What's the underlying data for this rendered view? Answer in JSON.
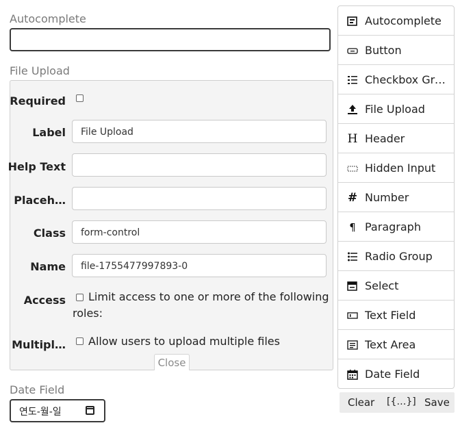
{
  "stage": {
    "autocomplete_label": "Autocomplete",
    "file_upload_label": "File Upload",
    "date_field_label": "Date Field",
    "date_placeholder": "연도-월-일"
  },
  "edit": {
    "required_label": "Required",
    "label_label": "Label",
    "label_value": "File Upload",
    "help_label": "Help Text",
    "help_value": "",
    "placeholder_label": "Placeh…",
    "placeholder_value": "",
    "class_label": "Class",
    "class_value": "form-control",
    "name_label": "Name",
    "name_value": "file-1755477997893-0",
    "access_label": "Access",
    "access_text_1": "Limit access to one or more of the following",
    "access_text_2": "roles:",
    "multiple_label": "Multipl…",
    "multiple_text": "Allow users to upload multiple files",
    "close_label": "Close"
  },
  "controls": [
    {
      "label": "Autocomplete",
      "icon": "autocomplete-icon"
    },
    {
      "label": "Button",
      "icon": "button-icon"
    },
    {
      "label": "Checkbox Gro…",
      "icon": "checkbox-group-icon"
    },
    {
      "label": "File Upload",
      "icon": "upload-icon"
    },
    {
      "label": "Header",
      "icon": "header-icon"
    },
    {
      "label": "Hidden Input",
      "icon": "hidden-input-icon"
    },
    {
      "label": "Number",
      "icon": "number-icon"
    },
    {
      "label": "Paragraph",
      "icon": "paragraph-icon"
    },
    {
      "label": "Radio Group",
      "icon": "radio-group-icon"
    },
    {
      "label": "Select",
      "icon": "select-icon"
    },
    {
      "label": "Text Field",
      "icon": "text-field-icon"
    },
    {
      "label": "Text Area",
      "icon": "text-area-icon"
    },
    {
      "label": "Date Field",
      "icon": "calendar-icon"
    }
  ],
  "actions": {
    "clear": "Clear",
    "data": "[{…}]",
    "save": "Save"
  }
}
